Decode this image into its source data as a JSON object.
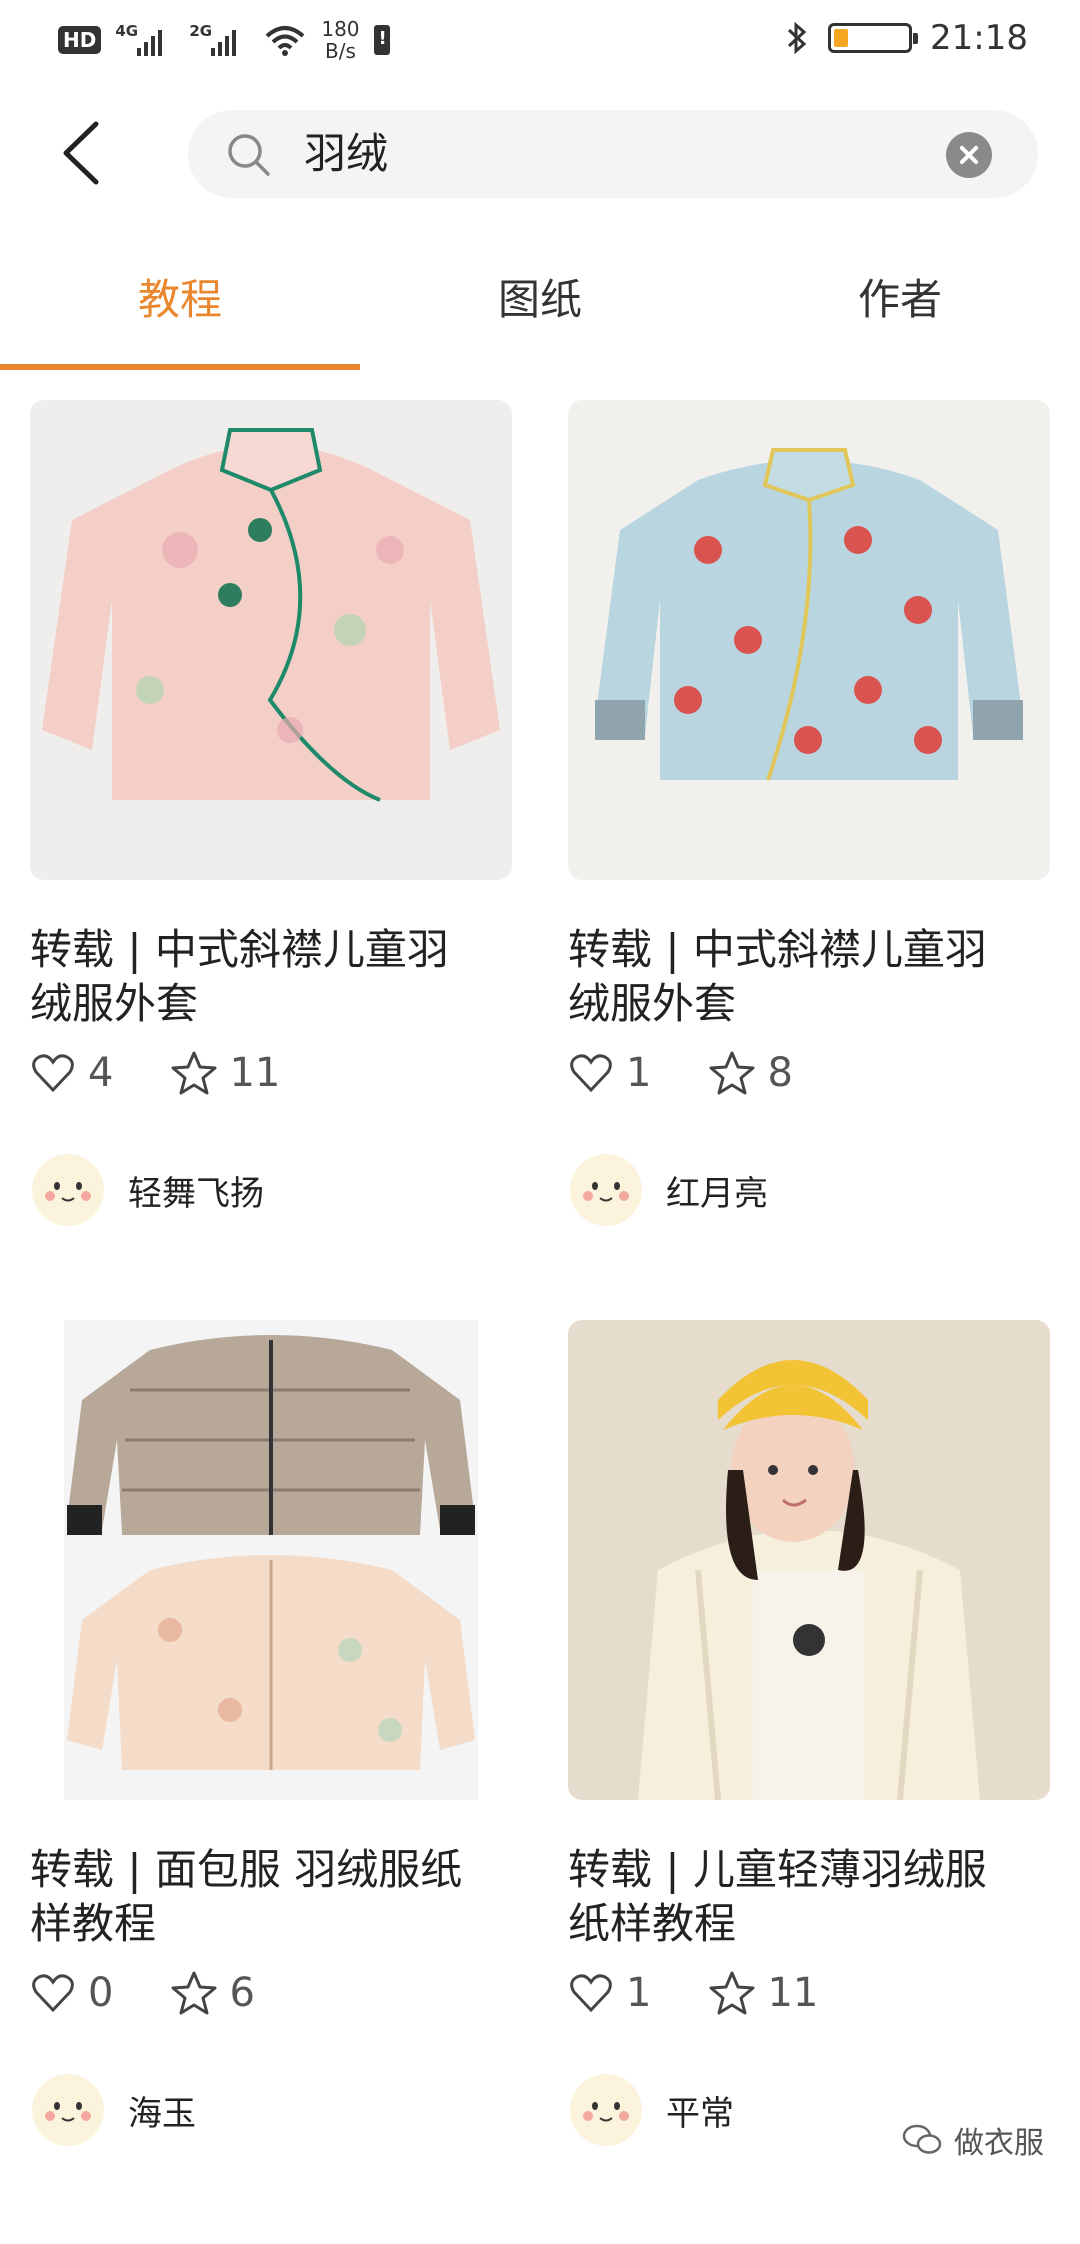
{
  "status_bar": {
    "hd": "HD",
    "net1": "4G",
    "net2": "2G",
    "speed_value": "180",
    "speed_unit": "B/s",
    "time": "21:18",
    "battery_level": 0.2
  },
  "search": {
    "query": "羽绒"
  },
  "tabs": [
    {
      "label": "教程",
      "active": true
    },
    {
      "label": "图纸",
      "active": false
    },
    {
      "label": "作者",
      "active": false
    }
  ],
  "cards": [
    {
      "title_line1": "转载 | 中式斜襟儿童羽",
      "title_line2": "绒服外套",
      "likes": "4",
      "favorites": "11",
      "author": "轻舞飞扬"
    },
    {
      "title_line1": "转载 | 中式斜襟儿童羽",
      "title_line2": "绒服外套",
      "likes": "1",
      "favorites": "8",
      "author": "红月亮"
    },
    {
      "title_line1": "转载 | 面包服 羽绒服纸",
      "title_line2": "样教程",
      "likes": "0",
      "favorites": "6",
      "author": "海玉"
    },
    {
      "title_line1": "转载 | 儿童轻薄羽绒服",
      "title_line2": "纸样教程",
      "likes": "1",
      "favorites": "11",
      "author": "平常"
    }
  ],
  "watermark": {
    "text": "做衣服"
  },
  "colors": {
    "accent": "#e8872e",
    "search_bg": "#f4f4f4"
  }
}
